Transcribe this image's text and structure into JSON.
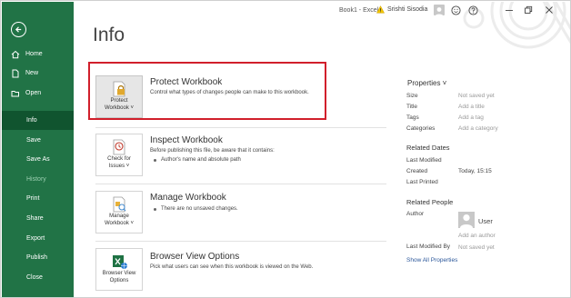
{
  "window": {
    "title": "Book1  -  Excel",
    "user_name": "Srishti Sisodia"
  },
  "sidebar": {
    "items": [
      {
        "label": "Home",
        "icon": "home-icon"
      },
      {
        "label": "New",
        "icon": "new-document-icon"
      },
      {
        "label": "Open",
        "icon": "folder-open-icon"
      },
      {
        "label": "Info"
      },
      {
        "label": "Save"
      },
      {
        "label": "Save As"
      },
      {
        "label": "History"
      },
      {
        "label": "Print"
      },
      {
        "label": "Share"
      },
      {
        "label": "Export"
      },
      {
        "label": "Publish"
      },
      {
        "label": "Close"
      }
    ],
    "active": "Info",
    "disabled": [
      "History"
    ]
  },
  "page": {
    "title": "Info"
  },
  "cards": [
    {
      "button_line1": "Protect",
      "button_line2": "Workbook ˅",
      "title": "Protect Workbook",
      "desc": "Control what types of changes people can make to this workbook.",
      "icon": "lock-icon"
    },
    {
      "button_line1": "Check for",
      "button_line2": "Issues ˅",
      "title": "Inspect Workbook",
      "desc": "Before publishing this file, be aware that it contains:",
      "bullets": [
        "Author's name and absolute path"
      ],
      "icon": "inspect-document-icon"
    },
    {
      "button_line1": "Manage",
      "button_line2": "Workbook ˅",
      "title": "Manage Workbook",
      "bullets": [
        "There are no unsaved changes."
      ],
      "icon": "manage-workbook-icon"
    },
    {
      "button_line1": "Browser View",
      "button_line2": "Options",
      "title": "Browser View Options",
      "desc": "Pick what users can see when this workbook is viewed on the Web.",
      "icon": "excel-web-icon"
    }
  ],
  "properties": {
    "heading": "Properties ˅",
    "rows": [
      {
        "label": "Size",
        "value": "Not saved yet"
      },
      {
        "label": "Title",
        "value": "Add a title"
      },
      {
        "label": "Tags",
        "value": "Add a tag"
      },
      {
        "label": "Categories",
        "value": "Add a category"
      }
    ],
    "related_dates": {
      "heading": "Related Dates",
      "rows": [
        {
          "label": "Last Modified",
          "value": ""
        },
        {
          "label": "Created",
          "value": "Today, 15:15"
        },
        {
          "label": "Last Printed",
          "value": ""
        }
      ]
    },
    "related_people": {
      "heading": "Related People",
      "author_label": "Author",
      "author_name": "User",
      "add_author": "Add an author",
      "last_modified_by_label": "Last Modified By",
      "last_modified_by_value": "Not saved yet"
    },
    "show_all": "Show All Properties"
  },
  "colors": {
    "sidebar": "#217346",
    "sidebar_active": "#10542f",
    "highlight": "#d11f2b",
    "link": "#2b579a"
  }
}
